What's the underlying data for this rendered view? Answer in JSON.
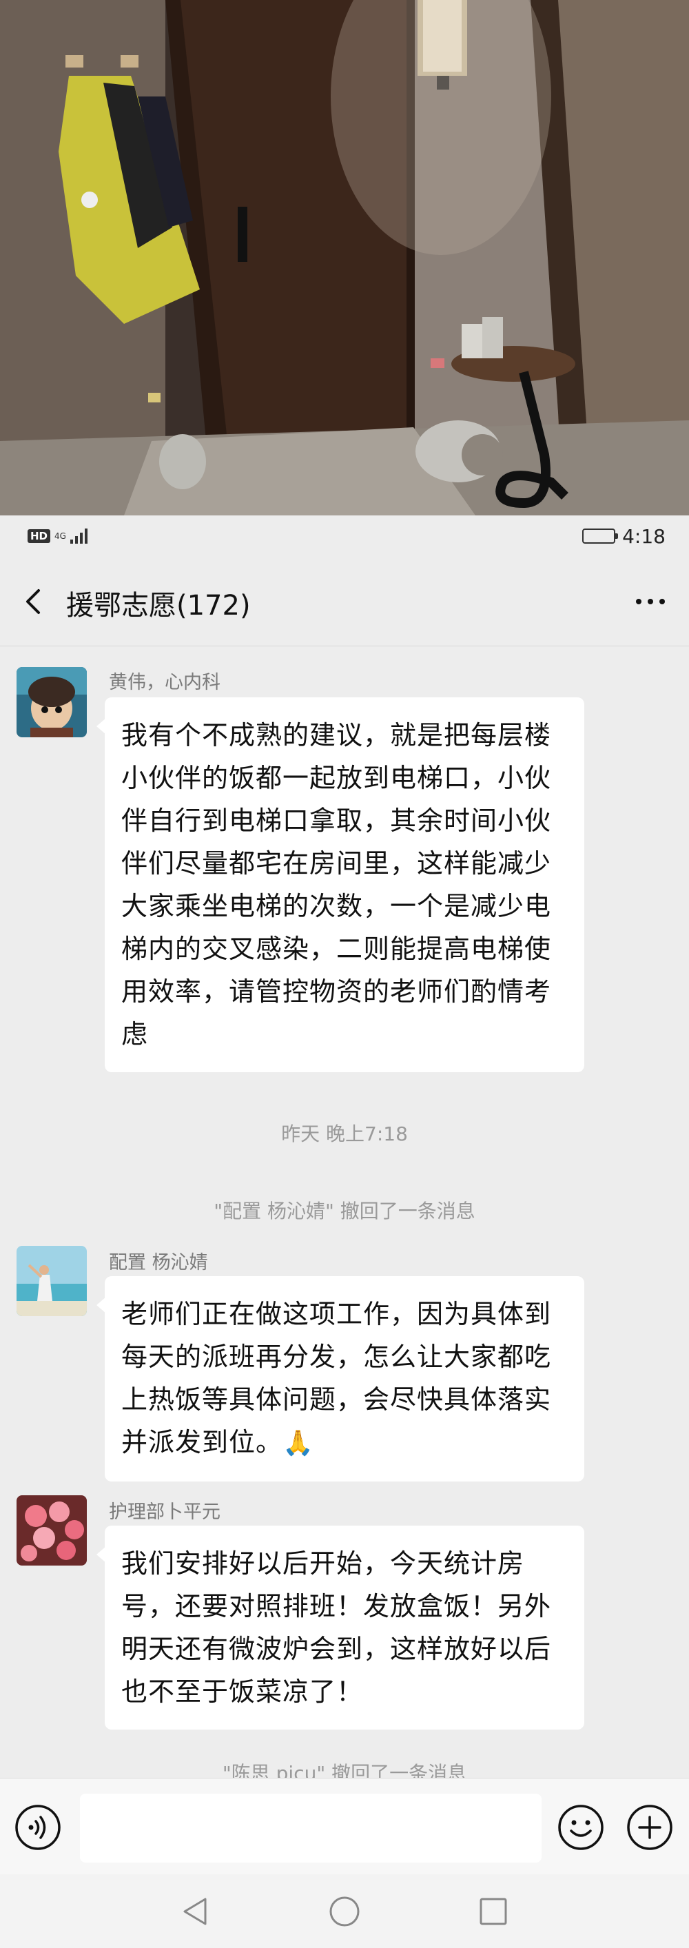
{
  "status_bar": {
    "hd_label": "HD",
    "network_label": "4G",
    "battery_level": 0.95,
    "time": "4:18"
  },
  "header": {
    "title": "援鄂志愿(172)",
    "back_icon": "chevron-left-icon",
    "more_icon": "more-horizontal-icon"
  },
  "messages": [
    {
      "type": "message",
      "sender": "黄伟，心内科",
      "text": "我有个不成熟的建议，就是把每层楼小伙伴的饭都一起放到电梯口，小伙伴自行到电梯口拿取，其余时间小伙伴们尽量都宅在房间里，这样能减少大家乘坐电梯的次数，一个是减少电梯内的交叉感染，二则能提高电梯使用效率，请管控物资的老师们酌情考虑"
    },
    {
      "type": "timestamp",
      "text": "昨天 晚上7:18"
    },
    {
      "type": "system",
      "text": "\"配置 杨沁婧\" 撤回了一条消息"
    },
    {
      "type": "message",
      "sender": "配置 杨沁婧",
      "text": "老师们正在做这项工作，因为具体到每天的派班再分发，怎么让大家都吃上热饭等具体问题，会尽快具体落实并派发到位。",
      "emoji": "🙏"
    },
    {
      "type": "message",
      "sender": "护理部卜平元",
      "text": "我们安排好以后开始，今天统计房号，还要对照排班！发放盒饭！另外明天还有微波炉会到，这样放好以后也不至于饭菜凉了！"
    },
    {
      "type": "system",
      "text": "\"陈思 picu\" 撤回了一条消息"
    }
  ],
  "input_bar": {
    "voice_icon": "voice-icon",
    "emoji_icon": "emoji-icon",
    "plus_icon": "plus-icon",
    "text_value": ""
  },
  "system_nav": {
    "back": "triangle-back-icon",
    "home": "circle-home-icon",
    "recents": "square-recents-icon"
  },
  "colors": {
    "background": "#ededed",
    "bubble": "#ffffff",
    "meta_text": "#9a9a9a"
  }
}
